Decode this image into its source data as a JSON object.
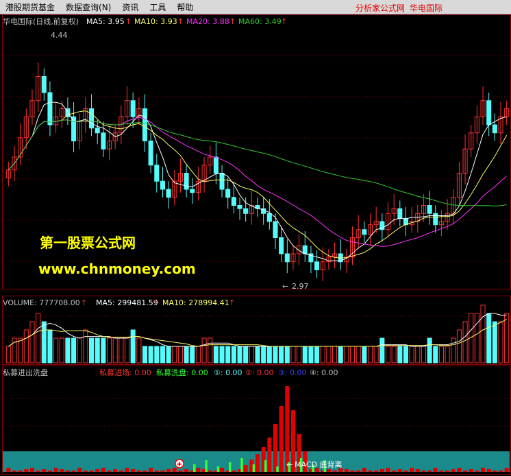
{
  "menu": {
    "items": [
      "港股期货基金",
      "数据查询(N)",
      "资讯",
      "工具",
      "帮助"
    ],
    "brand_right": "分析家公式网",
    "brand_right2": "华电国际"
  },
  "price_panel": {
    "header": {
      "title": "华电国际(日线,前复权)",
      "ma5": "MA5: 3.95",
      "ma10": "MA10: 3.93",
      "ma20": "MA20: 3.88",
      "ma60": "MA60: 3.49"
    },
    "high_label": "4.44",
    "low_label": "2.97",
    "watermark_title": "第一股票公式网",
    "watermark_url": "www.chnmoney.com"
  },
  "volume_panel": {
    "header": {
      "volume": "VOLUME: 777708.00",
      "ma5": "MA5: 299481.59",
      "ma10": "MA10: 278994.41"
    }
  },
  "indicator_panel": {
    "header": {
      "title": "私募进出洗盘",
      "entry": "私募进场: 0.00",
      "wash": "私募洗盘: 0.00",
      "c1": "①: 0.00",
      "c2": "②: 0.00",
      "c3": "③: 0.00",
      "c4": "④: 0.00"
    },
    "annotation": "MACD 底背离"
  },
  "colors": {
    "background": "#000000",
    "up_candle": "#ff3232",
    "down_candle": "#54fcfc",
    "ma5": "#ffffff",
    "ma10": "#ffff66",
    "ma20": "#ff33ff",
    "ma60": "#33cc33",
    "grid": "#8b0000",
    "watermark": "#ffff00",
    "teal_band": "#1a8a8a"
  },
  "chart_data": [
    {
      "type": "candlestick",
      "title": "华电国际(日线,前复权)",
      "ylim": [
        2.9,
        4.5
      ],
      "annotations": [
        {
          "label": "4.44"
        },
        {
          "label": "2.97"
        }
      ],
      "series": [
        {
          "name": "MA5",
          "last": 3.95
        },
        {
          "name": "MA10",
          "last": 3.93
        },
        {
          "name": "MA20",
          "last": 3.88
        },
        {
          "name": "MA60",
          "last": 3.49
        }
      ],
      "close": [
        3.62,
        3.7,
        3.82,
        3.95,
        4.05,
        4.2,
        4.1,
        3.9,
        3.95,
        4.0,
        3.95,
        3.8,
        3.92,
        4.0,
        3.88,
        3.85,
        3.75,
        3.8,
        3.85,
        3.95,
        4.05,
        3.95,
        4.0,
        3.8,
        3.65,
        3.55,
        3.5,
        3.45,
        3.55,
        3.6,
        3.5,
        3.48,
        3.55,
        3.65,
        3.7,
        3.6,
        3.5,
        3.45,
        3.4,
        3.38,
        3.35,
        3.4,
        3.38,
        3.35,
        3.3,
        3.2,
        3.1,
        3.05,
        3.1,
        3.15,
        3.1,
        3.05,
        3.0,
        3.05,
        3.08,
        3.1,
        3.05,
        3.08,
        3.2,
        3.25,
        3.22,
        3.28,
        3.3,
        3.25,
        3.35,
        3.38,
        3.32,
        3.28,
        3.3,
        3.35,
        3.4,
        3.35,
        3.28,
        3.3,
        3.35,
        3.45,
        3.6,
        3.75,
        3.85,
        3.95,
        4.05,
        3.9,
        3.85,
        3.95,
        4.0
      ]
    },
    {
      "type": "bar",
      "title": "VOLUME",
      "series": [
        {
          "name": "VOLUME",
          "last": 777708.0
        },
        {
          "name": "MA5",
          "last": 299481.59
        },
        {
          "name": "MA10",
          "last": 278994.41
        }
      ],
      "values": [
        2,
        3,
        3,
        4,
        5,
        6,
        5,
        4,
        3,
        3,
        3,
        3,
        3,
        4,
        3,
        3,
        3,
        3,
        3,
        3,
        3,
        4,
        3,
        2,
        2,
        2,
        2,
        2,
        2,
        2,
        2,
        2,
        2,
        3,
        3,
        2,
        2,
        2,
        2,
        2,
        2,
        2,
        2,
        2,
        2,
        2,
        2,
        2,
        2,
        2,
        2,
        2,
        2,
        2,
        2,
        2,
        2,
        2,
        2,
        2,
        2,
        2,
        2,
        3,
        2,
        2,
        2,
        2,
        2,
        2,
        2,
        3,
        2,
        2,
        2,
        3,
        4,
        5,
        6,
        6,
        7,
        6,
        5,
        5,
        6
      ]
    },
    {
      "type": "bar",
      "title": "私募进出洗盘",
      "series": [
        {
          "name": "私募进场",
          "last": 0.0
        },
        {
          "name": "私募洗盘",
          "last": 0.0
        }
      ],
      "annotations": [
        {
          "label": "MACD 底背离"
        }
      ]
    }
  ]
}
